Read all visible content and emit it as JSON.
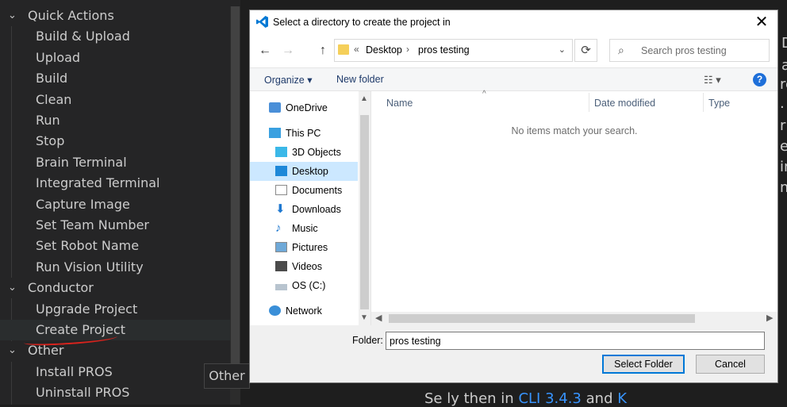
{
  "sidebar": {
    "sections": [
      {
        "label": "Quick Actions"
      },
      {
        "label": "Conductor"
      },
      {
        "label": "Other"
      }
    ],
    "quick_actions": [
      "Build & Upload",
      "Upload",
      "Build",
      "Clean",
      "Run",
      "Stop",
      "Brain Terminal",
      "Integrated Terminal",
      "Capture Image",
      "Set Team Number",
      "Set Robot Name",
      "Run Vision Utility"
    ],
    "conductor": [
      "Upgrade Project",
      "Create Project"
    ],
    "other": [
      "Install PROS",
      "Uninstall PROS"
    ],
    "tooltip": "Other",
    "colors": {
      "annotation": "#d8231d",
      "sidebar_bg": "#252526"
    }
  },
  "editor": {
    "partial_right": [
      "D",
      "a",
      "rc",
      ".",
      "ri",
      "er",
      "in",
      "m"
    ],
    "bottom_text": "Se",
    "bottom_fragment_1": "ly then",
    "bottom_fragment_2": "in",
    "bottom_link_1": "CLI 3.4.3",
    "bottom_fragment_3": "and",
    "bottom_link_2": "K"
  },
  "dialog": {
    "title": "Select a directory to create the project in",
    "close": "✕",
    "nav": {
      "back": "←",
      "forward": "→",
      "up": "↑"
    },
    "address": {
      "prefix": "«",
      "crumbs": [
        "Desktop",
        "pros testing"
      ]
    },
    "search_placeholder": "Search pros testing",
    "commands": {
      "organize": "Organize ▾",
      "new_folder": "New folder",
      "help": "?"
    },
    "tree": [
      {
        "label": "OneDrive",
        "icon": "cloud-icon"
      },
      {
        "label": "This PC",
        "icon": "computer-icon"
      },
      {
        "label": "3D Objects",
        "icon": "cube-icon"
      },
      {
        "label": "Desktop",
        "icon": "desktop-icon",
        "selected": true
      },
      {
        "label": "Documents",
        "icon": "document-icon"
      },
      {
        "label": "Downloads",
        "icon": "download-icon"
      },
      {
        "label": "Music",
        "icon": "music-icon"
      },
      {
        "label": "Pictures",
        "icon": "picture-icon"
      },
      {
        "label": "Videos",
        "icon": "video-icon"
      },
      {
        "label": "OS (C:)",
        "icon": "drive-icon"
      },
      {
        "label": "Network",
        "icon": "network-icon"
      }
    ],
    "columns": [
      "Name",
      "Date modified",
      "Type"
    ],
    "empty_message": "No items match your search.",
    "folder_label": "Folder:",
    "folder_value": "pros testing",
    "buttons": {
      "select": "Select Folder",
      "cancel": "Cancel"
    }
  }
}
